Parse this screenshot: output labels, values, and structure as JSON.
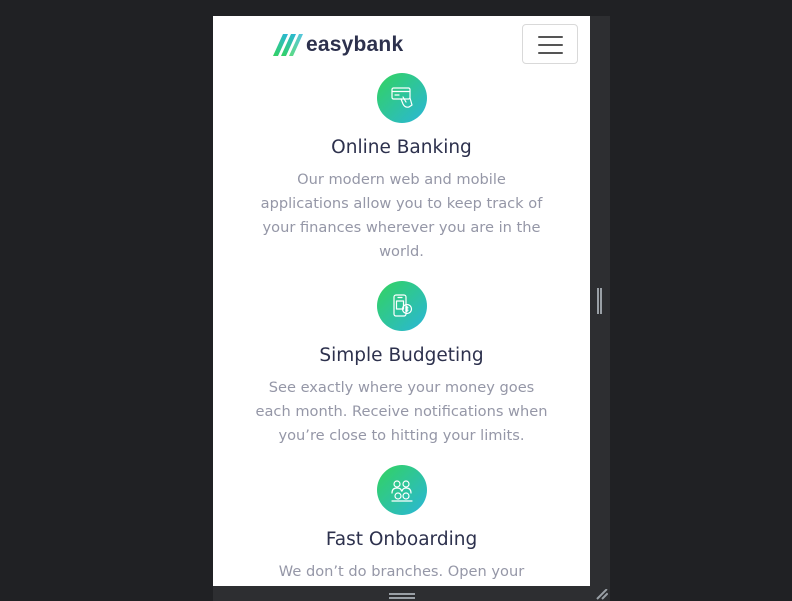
{
  "brand": {
    "name": "easybank",
    "colors": {
      "dark_blue": "#2d314d",
      "lime_green": "#31d35c",
      "bright_cyan": "#2bb7da",
      "grayish_blue": "#9597a7"
    }
  },
  "header": {
    "logo_icon": "easybank-logo-icon",
    "menu_icon": "hamburger-menu-icon"
  },
  "features": [
    {
      "icon": "online-banking-icon",
      "title": "Online Banking",
      "description": "Our modern web and mobile applications allow you to keep track of your finances wherever you are in the world."
    },
    {
      "icon": "budgeting-icon",
      "title": "Simple Budgeting",
      "description": "See exactly where your money goes each month. Receive notifications when you’re close to hitting your limits."
    },
    {
      "icon": "onboarding-icon",
      "title": "Fast Onboarding",
      "description": "We don’t do branches. Open your"
    }
  ],
  "devtools": {
    "side_handle": "resize-handle-icon",
    "bottom_handle": "resize-handle-icon",
    "corner_handle": "resize-corner-icon"
  }
}
